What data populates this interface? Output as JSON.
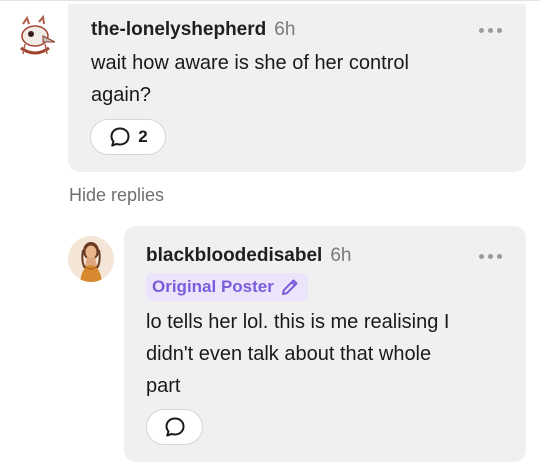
{
  "comment": {
    "username": "the-lonelyshepherd",
    "time": "6h",
    "text_line1": "wait how aware is she of her control",
    "text_line2": "again?",
    "reply_count": "2"
  },
  "hide_replies_label": "Hide replies",
  "reply": {
    "username": "blackbloodedisabel",
    "time": "6h",
    "badge": "Original Poster",
    "text_line1": "lo tells her lol. this is me realising I",
    "text_line2": "didn't even talk about that whole",
    "text_line3": "part"
  },
  "icons": {
    "comment_avatar": "bird-skull-avatar-icon",
    "reply_avatar": "woman-portrait-avatar-icon",
    "more": "ellipsis-icon",
    "reply_bubble": "speech-bubble-icon",
    "badge_icon": "pencil-icon"
  },
  "colors": {
    "bubble_bg": "#f0f0f0",
    "badge_bg": "#ebe4fb",
    "badge_text": "#7c5cdb",
    "secondary_text": "#7a7a7a"
  }
}
